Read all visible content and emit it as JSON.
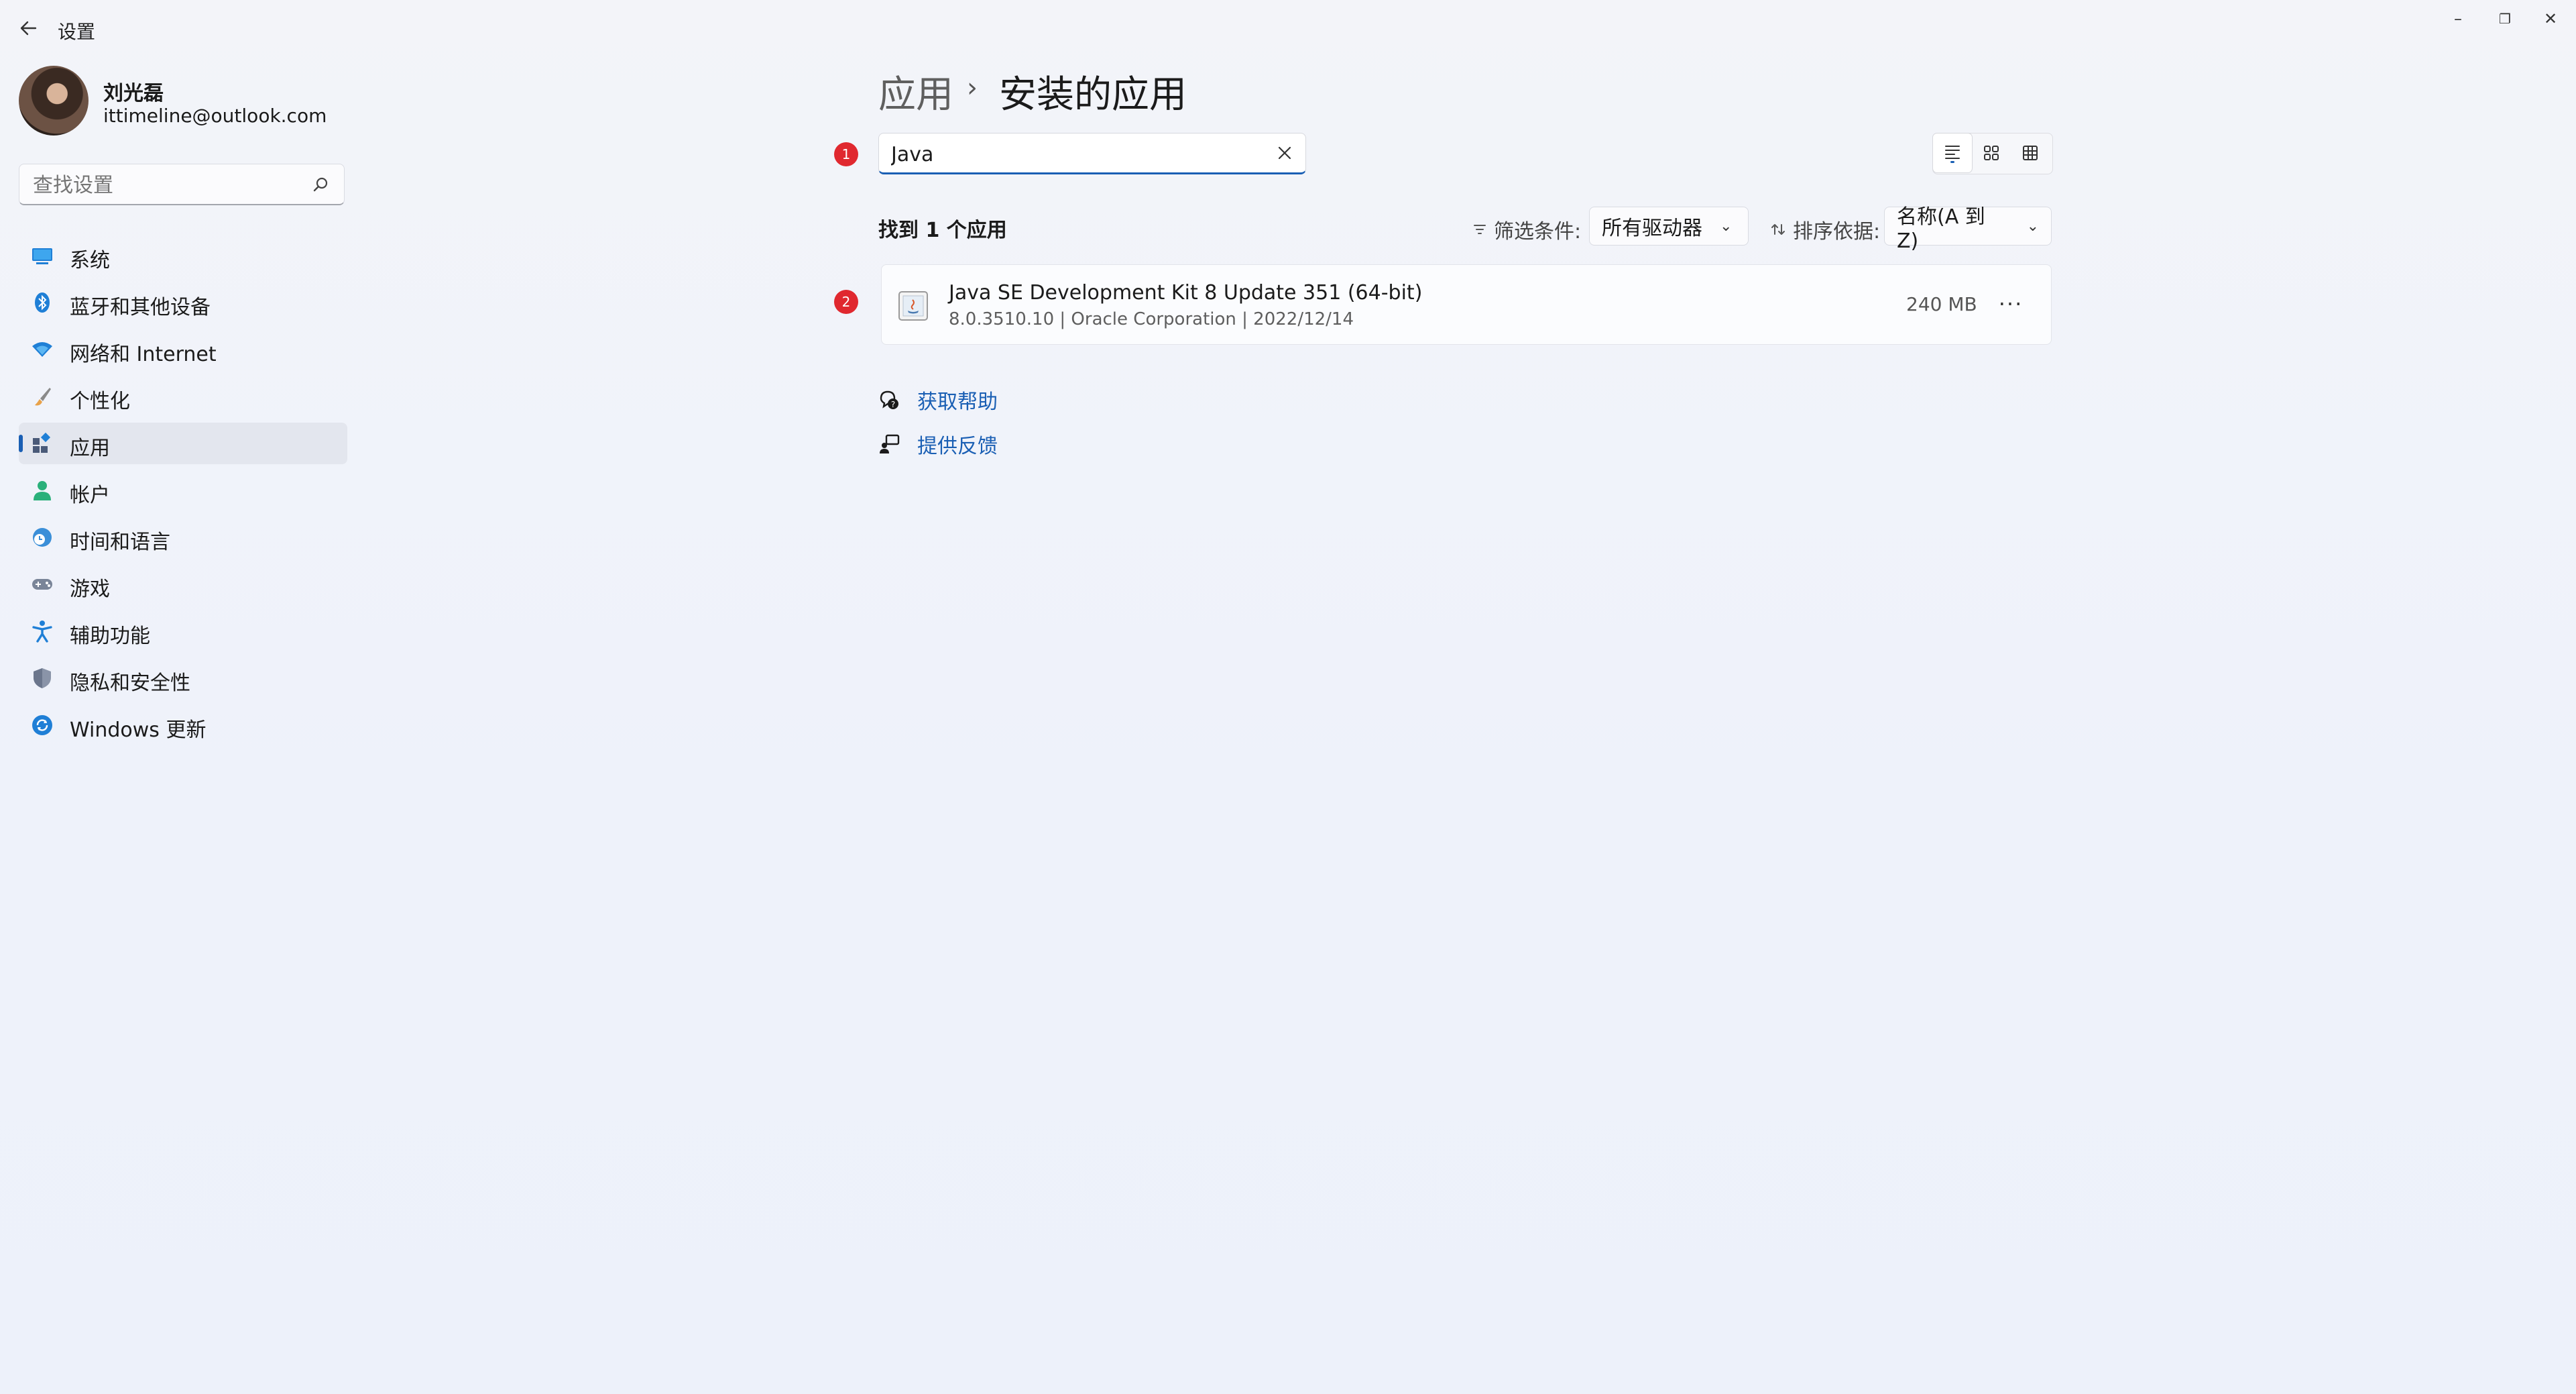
{
  "window": {
    "title": "设置",
    "controls": {
      "minimize": "–",
      "restore": "❐",
      "close": "✕"
    }
  },
  "profile": {
    "name": "刘光磊",
    "email": "ittimeline@outlook.com"
  },
  "sidebar": {
    "search_placeholder": "查找设置",
    "items": [
      {
        "label": "系统",
        "icon": "monitor-icon"
      },
      {
        "label": "蓝牙和其他设备",
        "icon": "bluetooth-icon"
      },
      {
        "label": "网络和 Internet",
        "icon": "wifi-icon"
      },
      {
        "label": "个性化",
        "icon": "brush-icon"
      },
      {
        "label": "应用",
        "icon": "apps-icon",
        "active": true
      },
      {
        "label": "帐户",
        "icon": "person-icon"
      },
      {
        "label": "时间和语言",
        "icon": "globe-clock-icon"
      },
      {
        "label": "游戏",
        "icon": "gamepad-icon"
      },
      {
        "label": "辅助功能",
        "icon": "accessibility-icon"
      },
      {
        "label": "隐私和安全性",
        "icon": "shield-icon"
      },
      {
        "label": "Windows 更新",
        "icon": "update-icon"
      }
    ]
  },
  "header": {
    "parent": "应用",
    "separator": "›",
    "current": "安装的应用"
  },
  "badges": {
    "one": "1",
    "two": "2"
  },
  "search": {
    "value": "Java"
  },
  "results": {
    "count_text": "找到 1 个应用",
    "filter_label": "筛选条件:",
    "filter_value": "所有驱动器",
    "sort_label": "排序依据:",
    "sort_value": "名称(A 到 Z)"
  },
  "apps": [
    {
      "name": "Java SE Development Kit 8 Update 351 (64-bit)",
      "meta": "8.0.3510.10  |  Oracle Corporation  |  2022/12/14",
      "size": "240 MB",
      "more": "···"
    }
  ],
  "links": {
    "help": "获取帮助",
    "feedback": "提供反馈"
  },
  "colors": {
    "accent": "#1a5fb4",
    "badge": "#e0282f",
    "background": "#f0f3fa"
  }
}
